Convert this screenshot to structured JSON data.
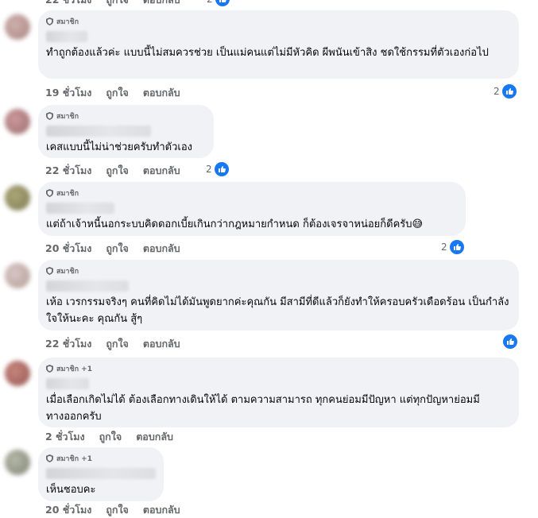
{
  "top_partial": {
    "actions": [
      "22 ชั่วโมง",
      "ถูกใจ",
      "ตอบกลับ"
    ],
    "reactions": "2"
  },
  "comments": [
    {
      "badge": "สมาชิก",
      "text": "ทำถูกต้องแล้วค่ะ แบบนี้ไม่สมควรช่วย เป็นแม่คนแต่ไม่มีหัวคิด ผีพนันเข้าสิง ชดใช้กรรมที่ตัวเองก่อไป",
      "time": "19 ชั่วโมง",
      "like": "ถูกใจ",
      "reply": "ตอบกลับ",
      "reactions": "2",
      "avatar_color": "#b08a88"
    },
    {
      "badge": "สมาชิก",
      "text": "เคสแบบนี้ไม่น่าช่วยครับทำตัวเอง",
      "time": "22 ชั่วโมง",
      "like": "ถูกใจ",
      "reply": "ตอบกลับ",
      "reactions": "2",
      "avatar_color": "#a87576"
    },
    {
      "badge": "สมาชิก",
      "text": "แต่ถ้าเจ้าหนี้นอกระบบคิดดอกเบี้ยเกินกว่ากฎหมายกำหนด ก็ต้องเจรจาหน่อยก็ดีครับ😅",
      "time": "20 ชั่วโมง",
      "like": "ถูกใจ",
      "reply": "ตอบกลับ",
      "reactions": "2",
      "avatar_color": "#8f8a5a"
    },
    {
      "badge": "สมาชิก",
      "text": "เห้อ เวรกรรมจริงๆ คนที่คิดไม่ได้มันพูดยากค่ะคุณกัน มีสามีที่ดีแล้วก็ยังทำให้ครอบครัวเดือดร้อน เป็นกำลังใจให้นะคะ คุณกัน สู้ๆ",
      "time": "22 ชั่วโมง",
      "like": "ถูกใจ",
      "reply": "ตอบกลับ",
      "reactions": "",
      "avatar_color": "#c2aca6"
    },
    {
      "badge": "สมาชิก +1",
      "text": "เมื่อเลือกเกิดไม่ได้ ต้องเลือกทางเดินให้ได้ ตามความสามารถ ทุกคนย่อมมีปัญหา แต่ทุกปัญหาย่อมมีทางออกครับ",
      "time": "2 ชั่วโมง",
      "like": "ถูกใจ",
      "reply": "ตอบกลับ",
      "reactions": "",
      "avatar_color": "#a0524c"
    },
    {
      "badge": "สมาชิก +1",
      "text": "เห็นชอบคะ",
      "time": "20 ชั่วโมง",
      "like": "ถูกใจ",
      "reply": "ตอบกลับ",
      "reactions": "",
      "avatar_color": "#8d9180"
    }
  ]
}
